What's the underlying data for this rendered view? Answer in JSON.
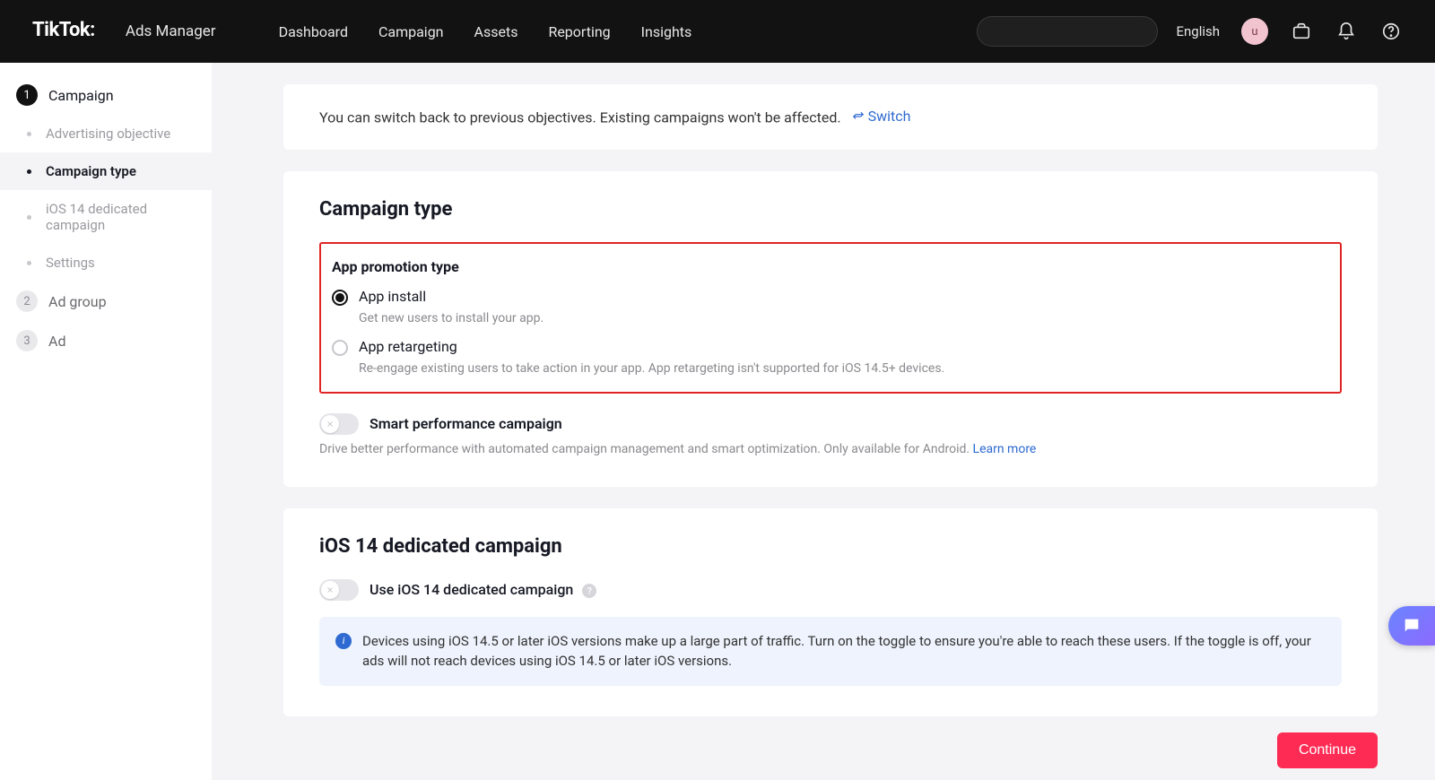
{
  "header": {
    "brand": "TikTok:",
    "product": "Ads Manager",
    "nav": [
      "Dashboard",
      "Campaign",
      "Assets",
      "Reporting",
      "Insights"
    ],
    "language": "English",
    "avatar_initial": "u"
  },
  "sidebar": {
    "steps": [
      {
        "num": "1",
        "label": "Campaign",
        "active": true
      },
      {
        "num": "2",
        "label": "Ad group",
        "active": false
      },
      {
        "num": "3",
        "label": "Ad",
        "active": false
      }
    ],
    "substeps": [
      {
        "label": "Advertising objective",
        "current": false
      },
      {
        "label": "Campaign type",
        "current": true
      },
      {
        "label": "iOS 14 dedicated campaign",
        "current": false
      },
      {
        "label": "Settings",
        "current": false
      }
    ]
  },
  "switch_card": {
    "text": "You can switch back to previous objectives. Existing campaigns won't be affected.",
    "link": "Switch"
  },
  "campaign_type": {
    "title": "Campaign type",
    "app_promo_label": "App promotion type",
    "options": [
      {
        "label": "App install",
        "desc": "Get new users to install your app.",
        "selected": true
      },
      {
        "label": "App retargeting",
        "desc": "Re-engage existing users to take action in your app. App retargeting isn't supported for iOS 14.5+ devices.",
        "selected": false
      }
    ],
    "smart": {
      "label": "Smart performance campaign",
      "desc": "Drive better performance with automated campaign management and smart optimization. Only available for Android. ",
      "learn_more": "Learn more"
    }
  },
  "ios14": {
    "title": "iOS 14 dedicated campaign",
    "toggle_label": "Use iOS 14 dedicated campaign",
    "info": "Devices using iOS 14.5 or later iOS versions make up a large part of traffic. Turn on the toggle to ensure you're able to reach these users. If the toggle is off, your ads will not reach devices using iOS 14.5 or later iOS versions."
  },
  "continue_label": "Continue"
}
